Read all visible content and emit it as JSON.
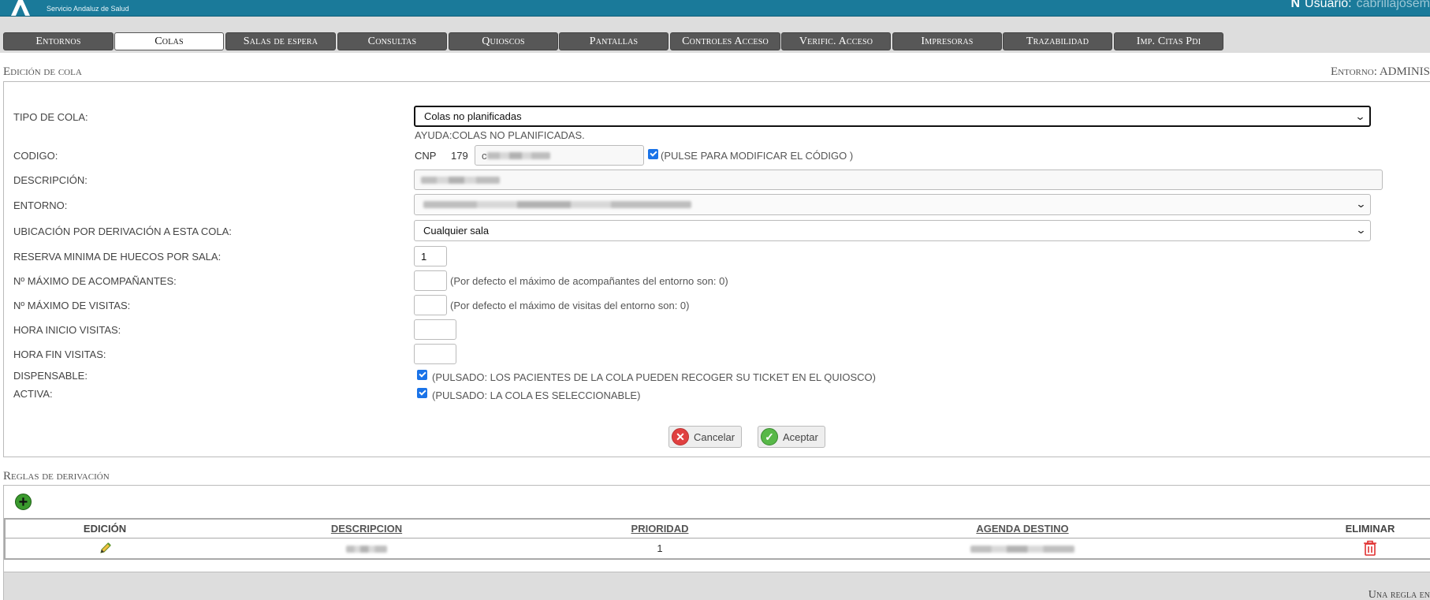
{
  "header": {
    "logo_subtitle": "Servicio Andaluz de Salud",
    "user_label": "Usuario:",
    "user_name": "cabrillajosem"
  },
  "tabs": [
    {
      "label": "Entornos",
      "active": false
    },
    {
      "label": "Colas",
      "active": true
    },
    {
      "label": "Salas de espera",
      "active": false
    },
    {
      "label": "Consultas",
      "active": false
    },
    {
      "label": "Quioscos",
      "active": false
    },
    {
      "label": "Pantallas",
      "active": false
    },
    {
      "label": "Controles Acceso",
      "active": false
    },
    {
      "label": "Verific. Acceso",
      "active": false
    },
    {
      "label": "Impresoras",
      "active": false
    },
    {
      "label": "Trazabilidad",
      "active": false
    },
    {
      "label": "Imp. Citas Pdi",
      "active": false
    }
  ],
  "edit_section": {
    "title": "Edición de cola",
    "environment_label": "Entorno: ADMINIS"
  },
  "form": {
    "tipo_label": "TIPO DE COLA:",
    "tipo_value": "Colas no planificadas",
    "ayuda": "AYUDA:COLAS NO PLANIFICADAS.",
    "codigo_label": "CODIGO:",
    "codigo_prefix": "CNP",
    "codigo_number": "179",
    "codigo_value": "c",
    "codigo_check_text": "(PULSE PARA MODIFICAR EL CÓDIGO )",
    "descripcion_label": "DESCRIPCIÓN:",
    "entorno_label": "ENTORNO:",
    "ubicacion_label": "UBICACIÓN POR DERIVACIÓN A ESTA COLA:",
    "ubicacion_value": "Cualquier sala",
    "reserva_label": "RESERVA MINIMA DE HUECOS POR SALA:",
    "reserva_value": "1",
    "acompanantes_label": "Nº MÁXIMO DE ACOMPAÑANTES:",
    "acompanantes_help": "(Por defecto el máximo de acompañantes del entorno son: 0)",
    "visitas_label": "Nº MÁXIMO DE VISITAS:",
    "visitas_help": "(Por defecto el máximo de visitas del entorno son: 0)",
    "hora_inicio_label": "HORA INICIO VISITAS:",
    "hora_fin_label": "HORA FIN VISITAS:",
    "dispensable_label": "DISPENSABLE:",
    "dispensable_text": "(PULSADO: LOS PACIENTES DE LA COLA PUEDEN RECOGER SU TICKET EN EL QUIOSCO)",
    "activa_label": "ACTIVA:",
    "activa_text": "(PULSADO: LA COLA ES SELECCIONABLE)",
    "cancel_label": "Cancelar",
    "accept_label": "Aceptar"
  },
  "rules_section": {
    "title": "Reglas de derivación",
    "columns": [
      "EDICIÓN",
      "DESCRIPCION",
      "PRIORIDAD",
      "AGENDA DESTINO",
      "ELIMINAR"
    ],
    "rows": [
      {
        "prioridad": "1"
      }
    ],
    "footer": "Una regla en"
  },
  "colors": {
    "header_bg": "#1a7a9a",
    "tab_bg": "#575757",
    "checkbox": "#1a73e8"
  }
}
